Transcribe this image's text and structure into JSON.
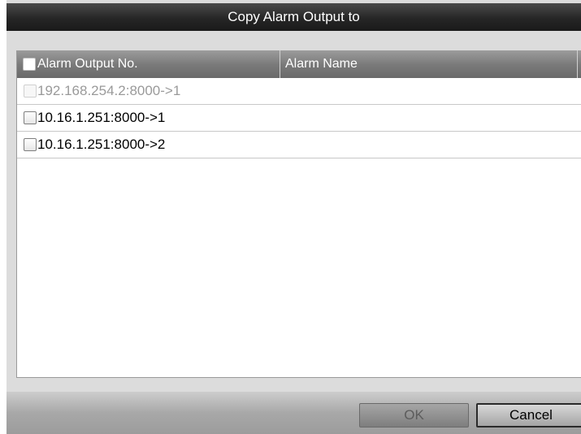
{
  "dialog": {
    "title": "Copy Alarm Output to"
  },
  "table": {
    "columns": [
      {
        "label": "Alarm Output No."
      },
      {
        "label": "Alarm Name"
      }
    ],
    "rows": [
      {
        "label": "192.168.254.2:8000->1",
        "checked": false,
        "disabled": true
      },
      {
        "label": "10.16.1.251:8000->1",
        "checked": false,
        "disabled": false
      },
      {
        "label": "10.16.1.251:8000->2",
        "checked": false,
        "disabled": false
      }
    ]
  },
  "footer": {
    "ok_label": "OK",
    "cancel_label": "Cancel"
  }
}
